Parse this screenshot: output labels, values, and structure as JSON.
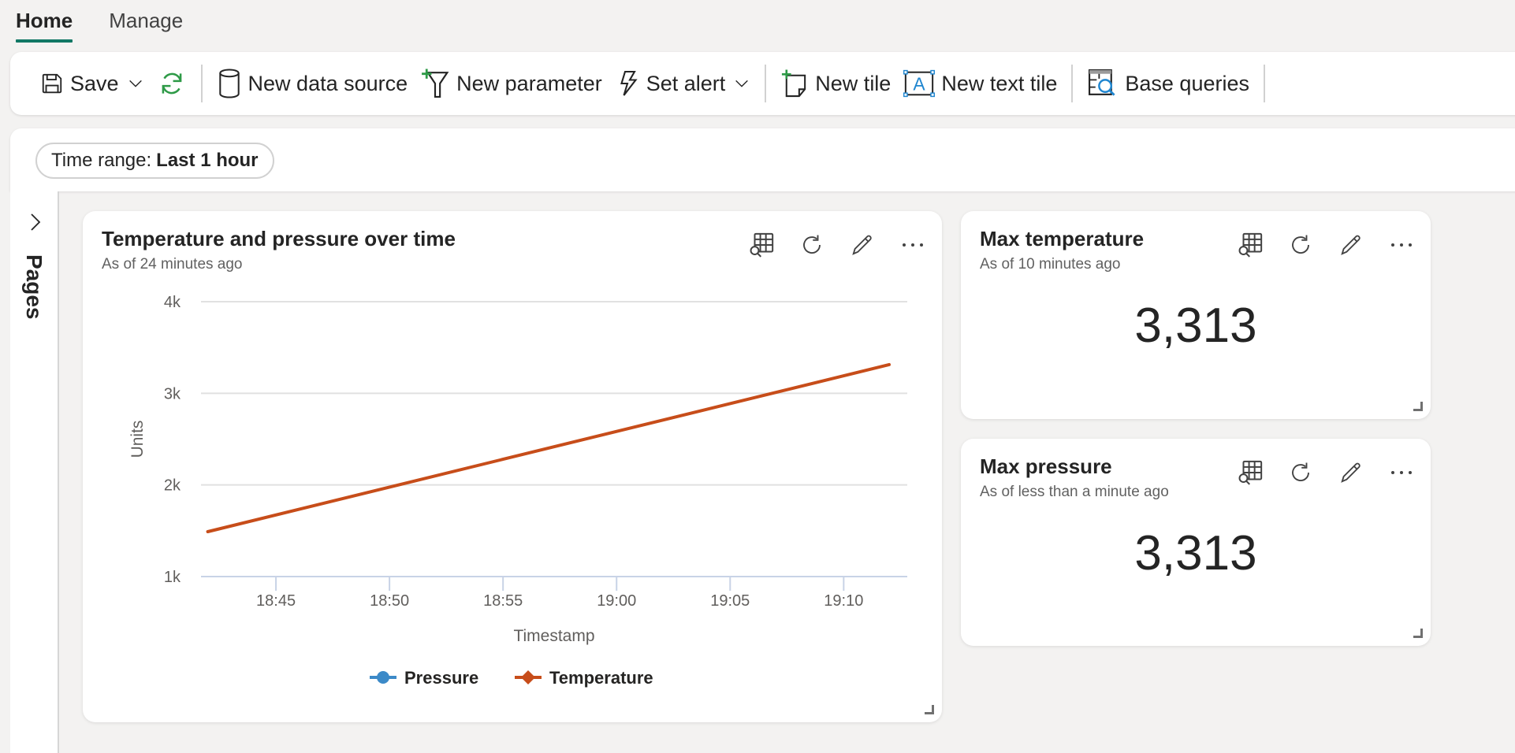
{
  "tabs": [
    {
      "label": "Home",
      "active": true
    },
    {
      "label": "Manage",
      "active": false
    }
  ],
  "toolbar": {
    "save_label": "Save",
    "new_data_source_label": "New data source",
    "new_parameter_label": "New parameter",
    "set_alert_label": "Set alert",
    "new_tile_label": "New tile",
    "new_text_tile_label": "New text tile",
    "base_queries_label": "Base queries",
    "colors": {
      "refresh": "#2e9a47",
      "plus": "#2e9a47",
      "accent_blue": "#1f86d0"
    }
  },
  "filter": {
    "prefix": "Time range:",
    "value": "Last 1 hour"
  },
  "sidebar": {
    "label": "Pages"
  },
  "tiles": {
    "chart": {
      "title": "Temperature and pressure over time",
      "subtitle": "As of 24 minutes ago"
    },
    "max_temperature": {
      "title": "Max temperature",
      "subtitle": "As of 10 minutes ago",
      "value": "3,313"
    },
    "max_pressure": {
      "title": "Max pressure",
      "subtitle": "As of less than a minute ago",
      "value": "3,313"
    }
  },
  "chart_data": {
    "type": "line",
    "title": "Temperature and pressure over time",
    "xlabel": "Timestamp",
    "ylabel": "Units",
    "x_ticks": [
      "18:45",
      "18:50",
      "18:55",
      "19:00",
      "19:05",
      "19:10"
    ],
    "x_range_minutes": [
      "18:41.7",
      "19:12.8"
    ],
    "y_ticks": [
      "1k",
      "2k",
      "3k",
      "4k"
    ],
    "ylim": [
      1000,
      4000
    ],
    "grid": true,
    "legend_position": "bottom",
    "series": [
      {
        "name": "Pressure",
        "color": "#3c8ac8",
        "points": []
      },
      {
        "name": "Temperature",
        "color": "#c74d1a",
        "points": [
          {
            "x": "18:42",
            "y": 1490
          },
          {
            "x": "19:12",
            "y": 3313
          }
        ]
      }
    ]
  }
}
